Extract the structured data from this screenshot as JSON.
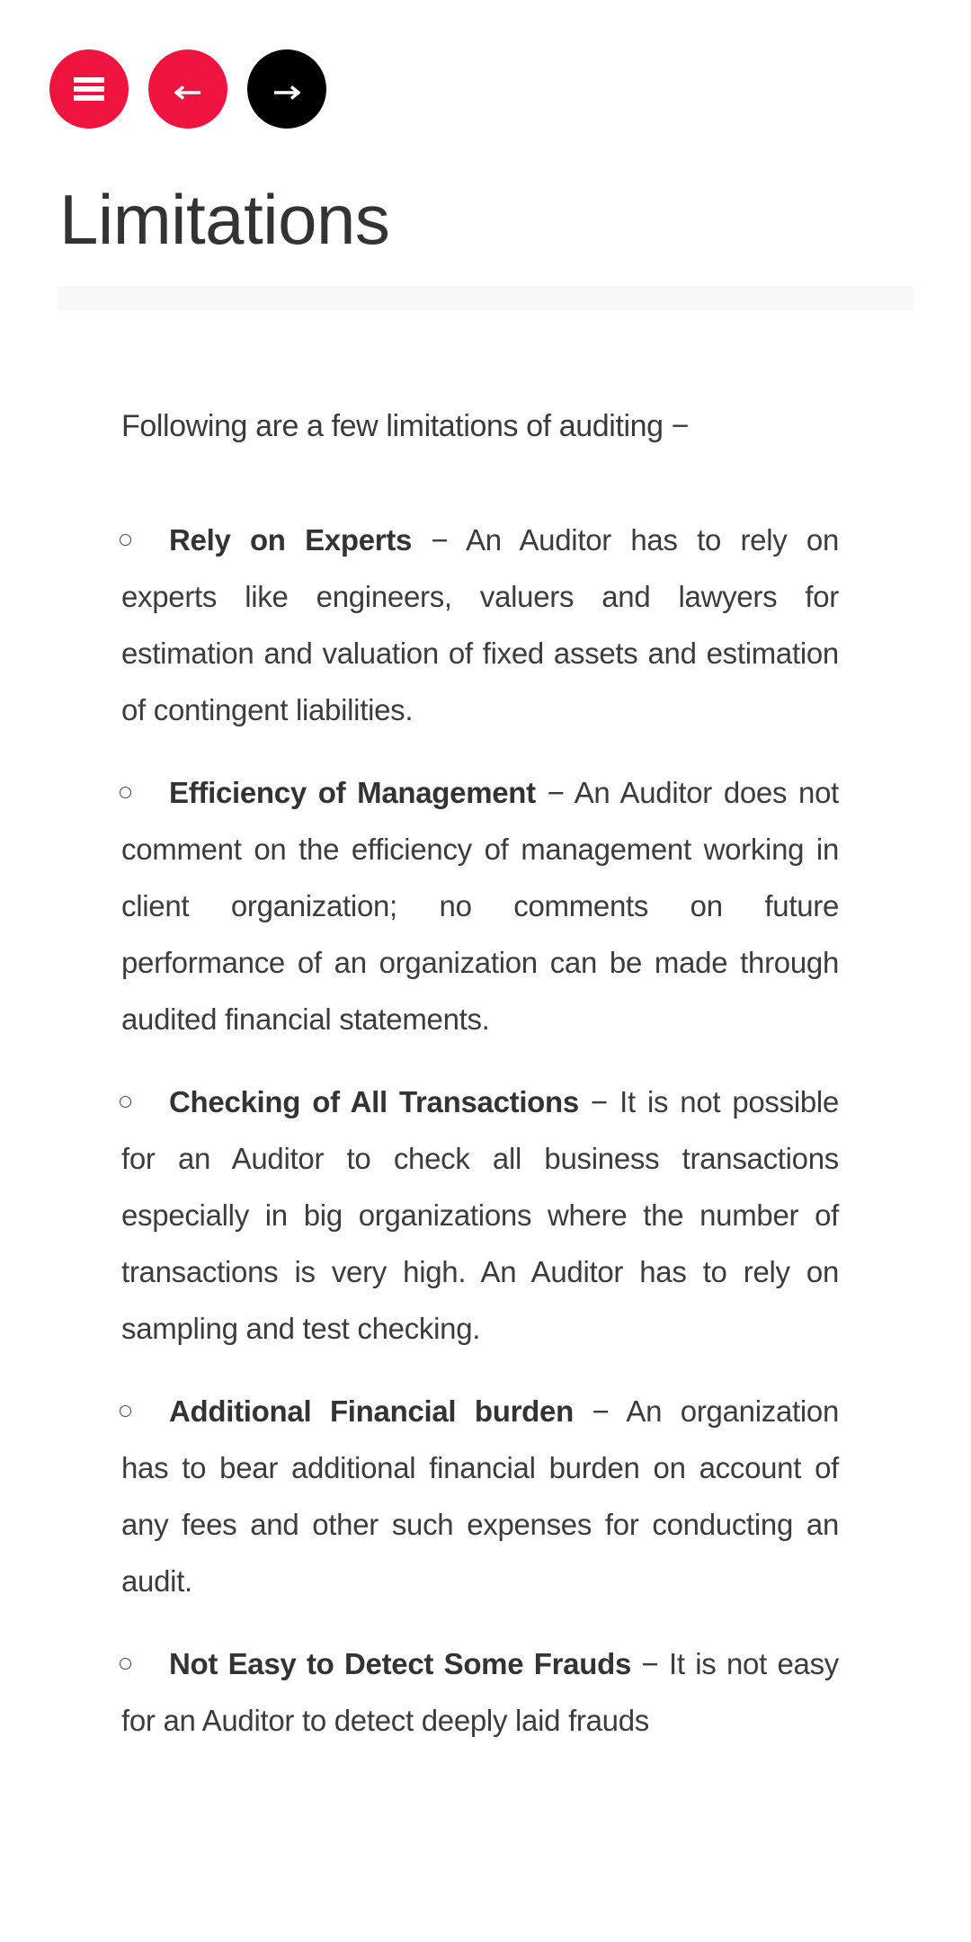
{
  "nav": {
    "menu_icon": "hamburger-menu-icon",
    "prev_icon": "arrow-left-icon",
    "next_icon": "arrow-right-icon",
    "colors": {
      "accent": "#ef1440",
      "next_button": "#000000"
    }
  },
  "page": {
    "title": "Limitations",
    "intro": "Following are a few limitations of auditing −"
  },
  "limitations": [
    {
      "term": "Rely on Experts",
      "separator": " − ",
      "description": "An Auditor has to rely on experts like engineers, valuers and lawyers for estimation and valuation of fixed assets and estimation of contingent liabilities."
    },
    {
      "term": "Efficiency of Management",
      "separator": " − ",
      "description": "An Auditor does not comment on the efficiency of management working in client organization; no comments on future performance of an organization can be made through audited financial statements."
    },
    {
      "term": "Checking of All Transactions",
      "separator": " − ",
      "description": "It is not possible for an Auditor to check all business transactions especially in big organizations where the number of transactions is very high. An Auditor has to rely on sampling and test checking."
    },
    {
      "term": "Additional Financial burden",
      "separator": " − ",
      "description": "An organization has to bear additional financial burden on account of any fees and other such expenses for conducting an audit."
    },
    {
      "term": "Not Easy to Detect Some Frauds",
      "separator": " − ",
      "description": "It is not easy for an Auditor to detect deeply laid frauds"
    }
  ]
}
